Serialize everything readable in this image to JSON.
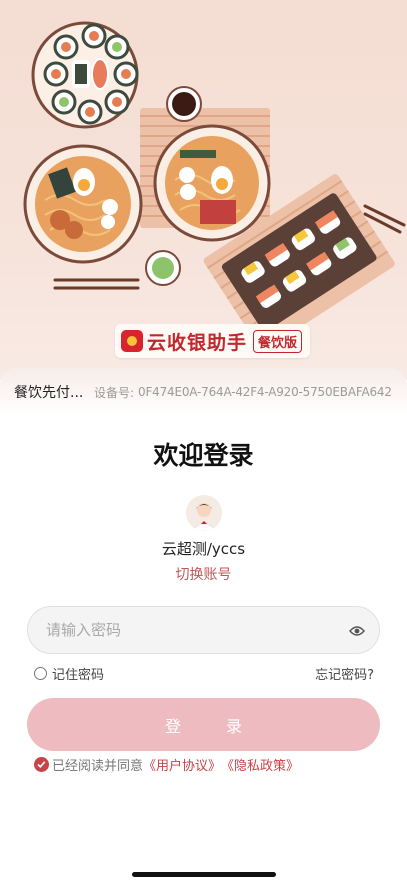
{
  "brand": {
    "name": "云收银助手",
    "tag": "餐饮版"
  },
  "device": {
    "store_name": "餐饮先付...",
    "label": "设备号:",
    "id": "0F474E0A-764A-42F4-A920-5750EBAFA642"
  },
  "login": {
    "title": "欢迎登录",
    "account": "云超测/yccs",
    "switch_account": "切换账号",
    "password_placeholder": "请输入密码",
    "remember_label": "记住密码",
    "forgot_label": "忘记密码?",
    "submit_label": "登 录",
    "agree_prefix": "已经阅读并同意",
    "user_agreement": "《用户协议》",
    "privacy_policy": "《隐私政策》"
  },
  "icons": {
    "brand_logo": "brand-logo-icon",
    "avatar": "user-avatar",
    "password_toggle": "eye-icon",
    "remember": "radio-unchecked-icon",
    "agree": "check-circle-icon"
  },
  "colors": {
    "accent": "#c7434a",
    "button": "#eebcc0",
    "brand_red": "#c1272d"
  }
}
